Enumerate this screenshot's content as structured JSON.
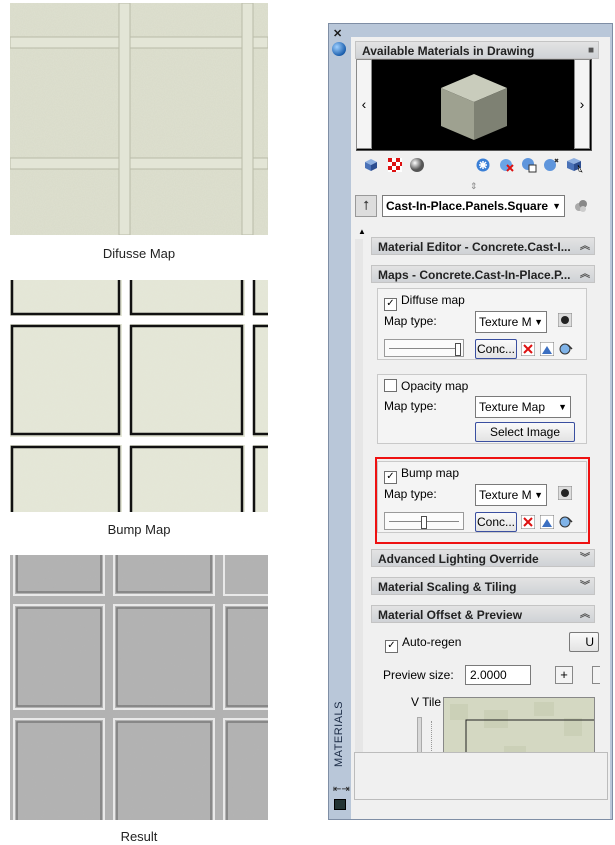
{
  "left_panel": {
    "captions": [
      "Difusse Map",
      "Bump Map",
      "Result"
    ]
  },
  "palette": {
    "title": "MATERIALS",
    "close_glyph": "✕",
    "available_section": "Available Materials in Drawing",
    "nav_left": "‹",
    "nav_right": "›",
    "current_material": "Cast-In-Place.Panels.Square",
    "sections": {
      "material_editor": "Material Editor - Concrete.Cast-I...",
      "maps": "Maps - Concrete.Cast-In-Place.P...",
      "advanced_lighting": "Advanced Lighting Override",
      "scaling_tiling": "Material Scaling & Tiling",
      "offset_preview": "Material Offset & Preview"
    },
    "diffuse": {
      "label": "Diffuse map",
      "checked": true,
      "map_type_label": "Map type:",
      "map_type_value": "Texture M",
      "conc_button": "Conc...",
      "slider_value": 1.0
    },
    "opacity": {
      "label": "Opacity map",
      "checked": false,
      "map_type_label": "Map type:",
      "map_type_value": "Texture Map",
      "select_button": "Select Image"
    },
    "bump": {
      "label": "Bump map",
      "checked": true,
      "map_type_label": "Map type:",
      "map_type_value": "Texture M",
      "conc_button": "Conc...",
      "slider_value": 0.5
    },
    "offset": {
      "auto_regen_label": "Auto-regen",
      "auto_regen_checked": true,
      "update_button": "U",
      "preview_size_label": "Preview size:",
      "preview_size_value": "2.0000",
      "plus_button": "+",
      "v_tile_label": "V Tile"
    },
    "icons": [
      "create-material-icon",
      "checker-icon",
      "sphere-icon",
      "apply-icon",
      "delete-icon",
      "attach-icon",
      "detach-icon",
      "select-objects-icon"
    ],
    "colors": {
      "highlight": "#e11111",
      "palette_frame": "#b9c7d9"
    }
  }
}
